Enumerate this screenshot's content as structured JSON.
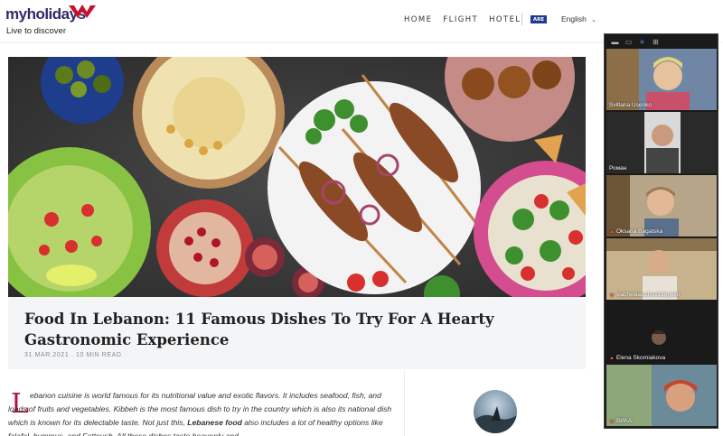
{
  "header": {
    "logo_text": "myholidays",
    "tagline": "Live to discover",
    "nav": [
      "HOME",
      "FLIGHT",
      "HOTEL"
    ],
    "flag_text": "ARE",
    "language": "English"
  },
  "article": {
    "title": "Food In Lebanon: 11 Famous Dishes To Try For A Hearty Gastronomic Experience",
    "meta": "31.MAR.2021 . 10 MIN READ",
    "dropcap": "L",
    "body_1": "ebanon cuisine is world famous for its nutritional value and exotic flavors. It includes seafood, fish, and loads of fruits and vegetables. Kibbeh is the most famous dish to try in the country which is also its national dish which is known for its delectable taste. Not just this, ",
    "body_bold": "Lebanese food",
    "body_2": " also includes a lot of healthy options like falafel, hummus, and Fattoush. All these dishes taste heavenly and"
  },
  "video_panel": {
    "participants": [
      {
        "name": "Svitlana Usenko",
        "muted": false
      },
      {
        "name": "Роман",
        "muted": false
      },
      {
        "name": "Oksana Bagatska",
        "muted": true
      },
      {
        "name": "viacheslav.zhovtobryukh",
        "muted": true
      },
      {
        "name": "Elena Skorniakova",
        "muted": true
      },
      {
        "name": "ВИКА",
        "muted": true
      }
    ]
  },
  "colors": {
    "brand_purple": "#2f2a6b",
    "brand_red": "#c8102e",
    "accent_dropcap": "#b0143a"
  }
}
